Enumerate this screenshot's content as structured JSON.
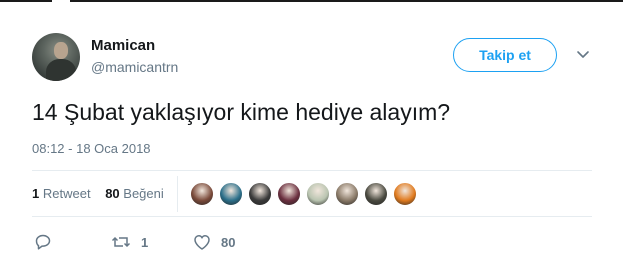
{
  "tweet": {
    "author": {
      "display_name": "Mamican",
      "username": "@mamicantrn"
    },
    "follow_button_label": "Takip et",
    "text": "14 Şubat yaklaşıyor kime hediye alayım?",
    "timestamp": "08:12 - 18 Oca 2018",
    "stats": {
      "retweets_count": "1",
      "retweets_label": "Retweet",
      "likes_count": "80",
      "likes_label": "Beğeni"
    },
    "liker_avatars": [
      {
        "name": "liker-1",
        "color": "#7a4a3a"
      },
      {
        "name": "liker-2",
        "color": "#2b6f8a"
      },
      {
        "name": "liker-3",
        "color": "#3a3a3a"
      },
      {
        "name": "liker-4",
        "color": "#6b2f3f"
      },
      {
        "name": "liker-5",
        "color": "#b9c4b0"
      },
      {
        "name": "liker-6",
        "color": "#8a7a68"
      },
      {
        "name": "liker-7",
        "color": "#4a4a40"
      },
      {
        "name": "liker-8",
        "color": "#e07a1e"
      }
    ],
    "actions": {
      "reply_icon": "reply-icon",
      "retweet_icon": "retweet-icon",
      "retweet_count": "1",
      "like_icon": "heart-icon",
      "like_count": "80"
    }
  },
  "colors": {
    "accent": "#1da1f2",
    "muted": "#657786",
    "text": "#14171a",
    "divider": "#e6ecf0"
  }
}
